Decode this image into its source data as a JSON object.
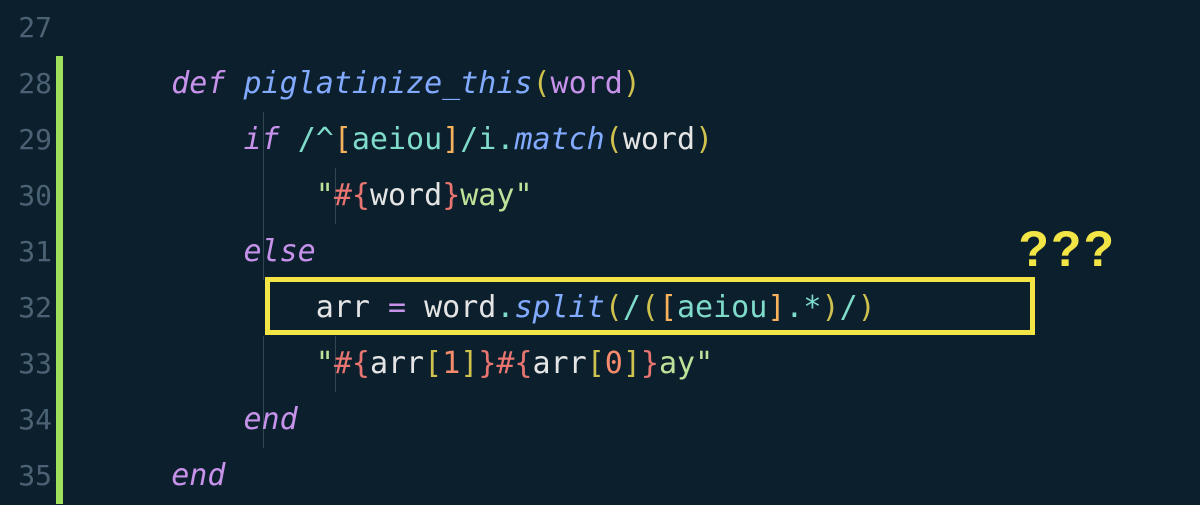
{
  "line_numbers": [
    "27",
    "28",
    "29",
    "30",
    "31",
    "32",
    "33",
    "34",
    "35"
  ],
  "annotation": {
    "question": "???"
  },
  "tokens": {
    "def": "def ",
    "fn_name": "piglatinize_this",
    "lp": "(",
    "rp": ")",
    "param": "word",
    "if": "if ",
    "else": "else",
    "end": "end",
    "regex1_open": "/^",
    "regex1_br_open": "[",
    "regex1_chars": "aeiou",
    "regex1_br_close": "]",
    "regex1_close": "/i",
    "dot": ".",
    "match": "match",
    "split": "split",
    "quote": "\"",
    "interp_open": "#{",
    "interp_close": "}",
    "way": "way",
    "ay": "ay",
    "arr": "arr",
    "eq": " = ",
    "regex2_open": "/",
    "regex2_paren_open": "(",
    "regex2_br_open": "[",
    "regex2_chars": "aeiou",
    "regex2_br_close": "]",
    "regex2_rest": ".*",
    "regex2_paren_close": ")",
    "regex2_close": "/",
    "lbrk": "[",
    "rbrk": "]",
    "one": "1",
    "zero": "0"
  }
}
